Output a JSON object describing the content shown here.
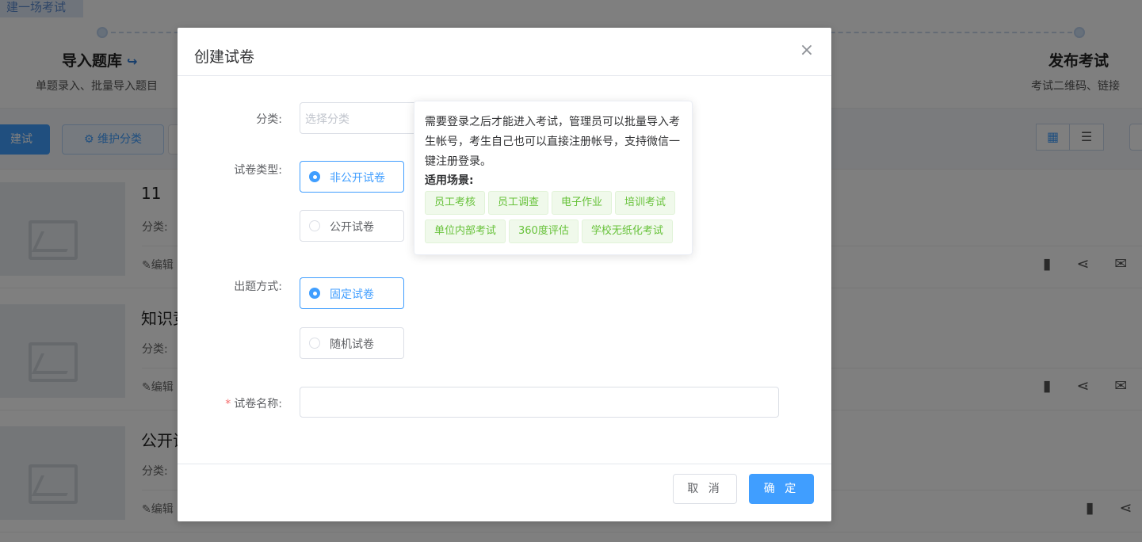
{
  "background": {
    "top_tab": "建一场考试",
    "steps": [
      {
        "title": "导入题库",
        "desc": "单题录入、批量导入题目"
      },
      {
        "title": "发布考试",
        "desc": "考试二维码、链接"
      }
    ],
    "toolbar": {
      "create_label": "建试卷",
      "maintain_label": "维护分类"
    },
    "cards": [
      {
        "title": "11",
        "meta": "分类:",
        "edit": "编辑"
      },
      {
        "title": "知识竞",
        "meta": "分类:",
        "edit": "编辑"
      },
      {
        "title": "公开试",
        "meta": "分类:",
        "edit": "编辑"
      }
    ]
  },
  "dialog": {
    "title": "创建试卷",
    "close_icon": "×",
    "category": {
      "label": "分类:",
      "placeholder": "选择分类"
    },
    "paper_type": {
      "label": "试卷类型:",
      "options": [
        "非公开试卷",
        "公开试卷"
      ],
      "selected": "非公开试卷"
    },
    "question_mode": {
      "label": "出题方式:",
      "options": [
        "固定试卷",
        "随机试卷"
      ],
      "selected": "固定试卷"
    },
    "paper_name": {
      "required_mark": "*",
      "label": "试卷名称:",
      "value": ""
    },
    "footer": {
      "cancel_label": "取 消",
      "confirm_label": "确 定"
    }
  },
  "popover": {
    "description": "需要登录之后才能进入考试，管理员可以批量导入考生帐号，考生自己也可以直接注册帐号，支持微信一键注册登录。",
    "scenarios_title": "适用场景:",
    "tags": [
      "员工考核",
      "员工调查",
      "电子作业",
      "培训考试",
      "单位内部考试",
      "360度评估",
      "学校无纸化考试"
    ]
  },
  "colors": {
    "primary": "#409eff",
    "tag_green": "#67c23a",
    "required": "#f56c6c"
  }
}
